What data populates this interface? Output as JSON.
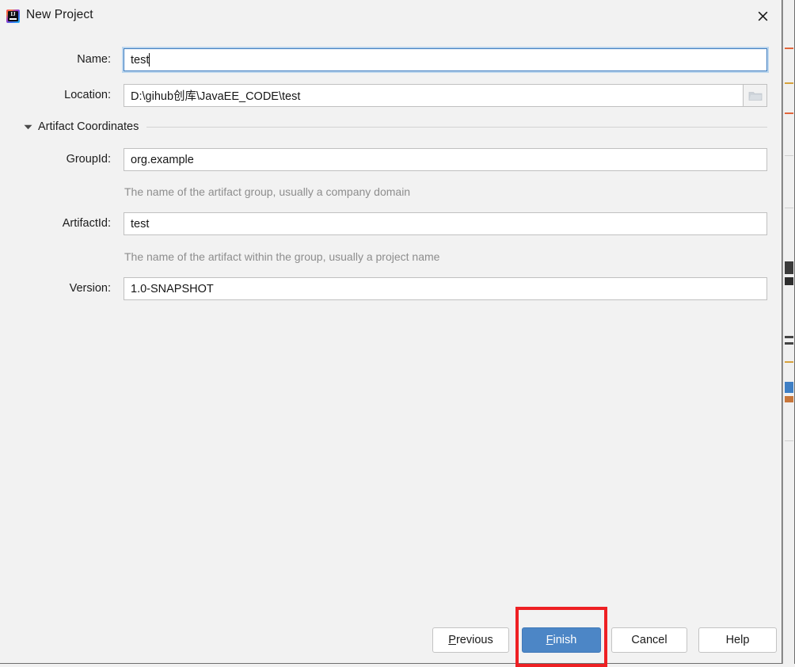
{
  "window": {
    "title": "New Project",
    "icon": "intellij-idea-icon",
    "icon_text": "IJ",
    "close_icon": "close-icon"
  },
  "form": {
    "name": {
      "label": "Name:",
      "value": "test",
      "focused": true
    },
    "location": {
      "label": "Location:",
      "value": "D:\\gihub创库\\JavaEE_CODE\\test",
      "browse_icon": "folder-icon"
    }
  },
  "section": {
    "title": "Artifact Coordinates",
    "expanded": true,
    "toggle_icon": "chevron-down-icon",
    "fields": {
      "group_id": {
        "label": "GroupId:",
        "value": "org.example",
        "help": "The name of the artifact group, usually a company domain"
      },
      "artifact_id": {
        "label": "ArtifactId:",
        "value": "test",
        "help": "The name of the artifact within the group, usually a project name"
      },
      "version": {
        "label": "Version:",
        "value": "1.0-SNAPSHOT",
        "help": ""
      }
    }
  },
  "buttons": {
    "previous": {
      "mnemonic": "P",
      "rest": "revious"
    },
    "finish": {
      "mnemonic": "F",
      "rest": "inish"
    },
    "cancel": {
      "label": "Cancel"
    },
    "help": {
      "label": "Help"
    }
  },
  "annotation": {
    "type": "rectangle-highlight",
    "target": "finish-button",
    "color": "#ee2023"
  },
  "colors": {
    "dialog_background": "#f2f2f2",
    "primary_button": "#4c86c6",
    "field_border": "#c0c0c0",
    "focus_ring": "#bcd6ee",
    "help_text": "#8d8d8d",
    "annotation_red": "#ee2023"
  }
}
